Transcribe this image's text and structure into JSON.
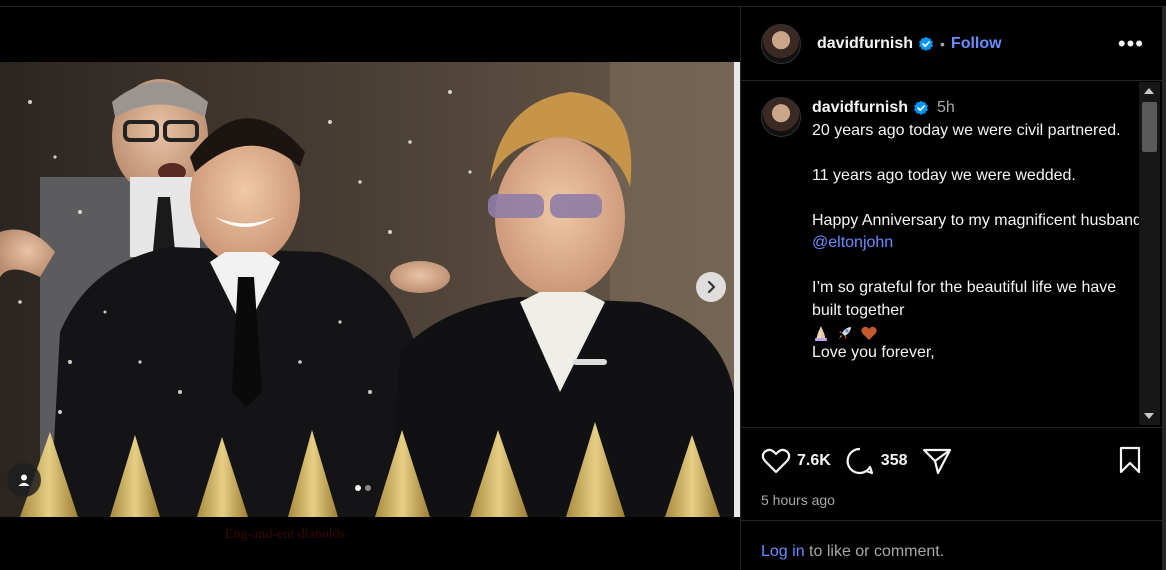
{
  "post": {
    "username": "davidfurnish",
    "follow_label": "Follow",
    "separator": "•",
    "more_label": "•••",
    "time_ago": "5h",
    "caption": [
      "20 years ago today we were civil partnered.",
      "11 years ago today we were wedded.",
      "Happy Anniversary to my magnificent husband",
      "I’m so grateful for the beautiful life we have built together",
      "Love you forever,"
    ],
    "mention": "@eltonjohn",
    "emoji_icons": [
      "praying-hands-icon",
      "rocket-icon",
      "heart-icon"
    ],
    "likes": "7.6K",
    "comments_count": "358",
    "timestamp": "5 hours ago"
  },
  "media": {
    "slide_count": 2,
    "active_slide": 1,
    "overlay_caption": "Eng-and-ent dianolds",
    "icons": {
      "next": "chevron-right-icon",
      "tag": "user-tag-icon"
    }
  },
  "footer": {
    "login_link": "Log in",
    "login_text": " to like or comment."
  },
  "colors": {
    "background": "#000000",
    "text": "#f5f5f5",
    "muted": "#a8a8a8",
    "link": "#6b8dff",
    "border": "#262626",
    "verified": "#0095f6"
  }
}
